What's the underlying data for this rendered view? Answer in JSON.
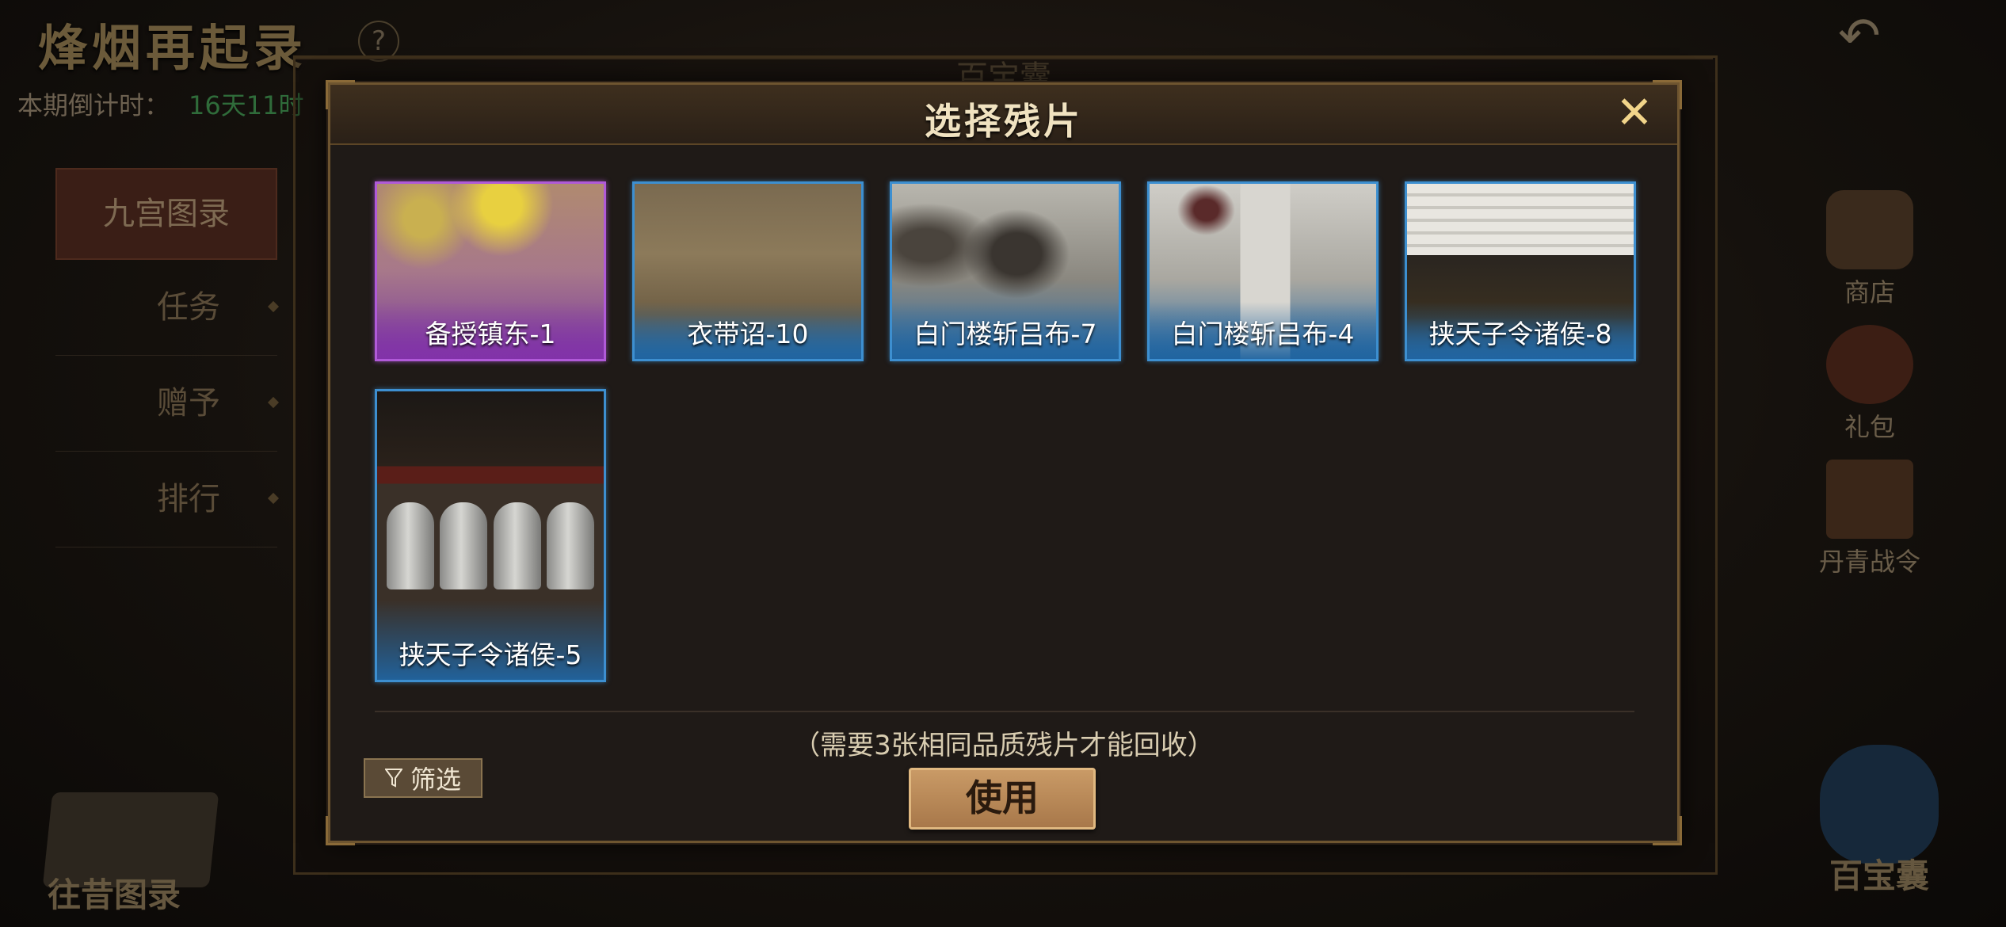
{
  "background": {
    "event_title": "烽烟再起录",
    "help_icon": "question-icon",
    "countdown_label": "本期倒计时：",
    "countdown_value": "16天11时",
    "top_frame_title": "百宝囊",
    "left_nav": {
      "active": "九宫图录",
      "items": [
        "任务",
        "赠予",
        "排行"
      ]
    },
    "right_nav": [
      "商店",
      "礼包",
      "丹青战令"
    ],
    "bottom_left_label": "往昔图录",
    "bottom_right_label": "百宝囊"
  },
  "dialog": {
    "title": "选择残片",
    "close_icon": "close-icon",
    "cards": [
      {
        "label": "备授镇东-1",
        "quality": "purple"
      },
      {
        "label": "衣带诏-10",
        "quality": "blue"
      },
      {
        "label": "白门楼斩吕布-7",
        "quality": "blue"
      },
      {
        "label": "白门楼斩吕布-4",
        "quality": "blue"
      },
      {
        "label": "挟天子令诸侯-8",
        "quality": "blue"
      },
      {
        "label": "挟天子令诸侯-5",
        "quality": "blue"
      }
    ],
    "hint": "（需要3张相同品质残片才能回收）",
    "filter_label": "筛选",
    "use_label": "使用"
  },
  "colors": {
    "purple_quality": "#b05ad8",
    "blue_quality": "#3d8fd0",
    "gold_accent": "#f2d58a"
  }
}
